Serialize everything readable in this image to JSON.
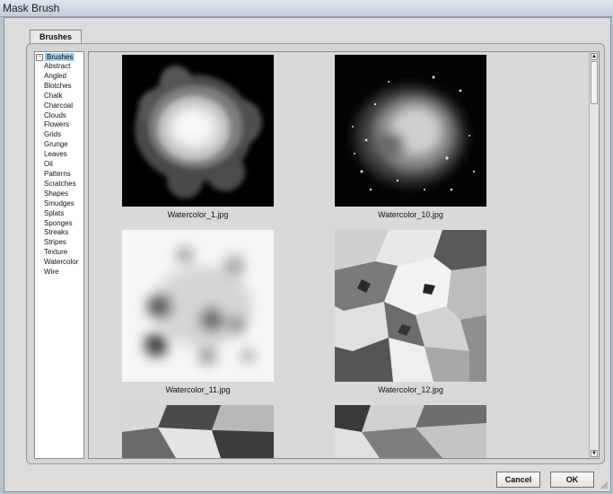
{
  "window": {
    "title": "Mask Brush"
  },
  "tabs": [
    {
      "label": "Brushes"
    }
  ],
  "tree": {
    "root": "Brushes",
    "items": [
      "Abstract",
      "Angled",
      "Blotches",
      "Chalk",
      "Charcoal",
      "Clouds",
      "Flowers",
      "Grids",
      "Grunge",
      "Leaves",
      "Oil",
      "Patterns",
      "Scratches",
      "Shapes",
      "Smudges",
      "Splats",
      "Sponges",
      "Streaks",
      "Stripes",
      "Texture",
      "Watercolor",
      "Wire"
    ]
  },
  "gallery": {
    "items": [
      {
        "caption": "Watercolor_1.jpg"
      },
      {
        "caption": "Watercolor_10.jpg"
      },
      {
        "caption": "Watercolor_11.jpg"
      },
      {
        "caption": "Watercolor_12.jpg"
      },
      {
        "caption": ""
      },
      {
        "caption": ""
      }
    ]
  },
  "buttons": {
    "cancel": "Cancel",
    "ok": "OK"
  }
}
